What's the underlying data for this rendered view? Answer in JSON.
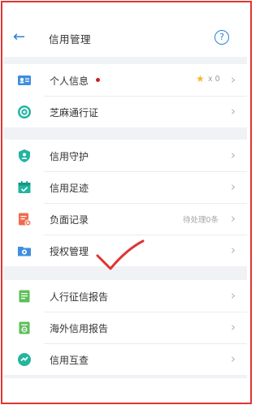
{
  "header": {
    "back_icon": "arrow-left-icon",
    "title": "信用管理",
    "help_glyph": "?"
  },
  "sections": {
    "account": [
      {
        "label": "个人信息",
        "icon": "id-card-icon",
        "star_count": "x 0"
      },
      {
        "label": "芝麻通行证",
        "icon": "pass-ring-icon"
      }
    ],
    "management": [
      {
        "label": "信用守护",
        "icon": "shield-icon"
      },
      {
        "label": "信用足迹",
        "icon": "calendar-icon"
      },
      {
        "label": "负面记录",
        "icon": "record-x-icon",
        "status": "待处理0条"
      },
      {
        "label": "授权管理",
        "icon": "folder-gear-icon"
      }
    ],
    "reports": [
      {
        "label": "人行征信报告",
        "icon": "report-icon"
      },
      {
        "label": "海外信用报告",
        "icon": "overseas-report-icon"
      },
      {
        "label": "信用互查",
        "icon": "swap-check-icon"
      }
    ]
  },
  "colors": {
    "accent": "#2383d9",
    "red_dot": "#cc1f1f",
    "annotation": "#e03434",
    "star": "#f4b72f"
  }
}
